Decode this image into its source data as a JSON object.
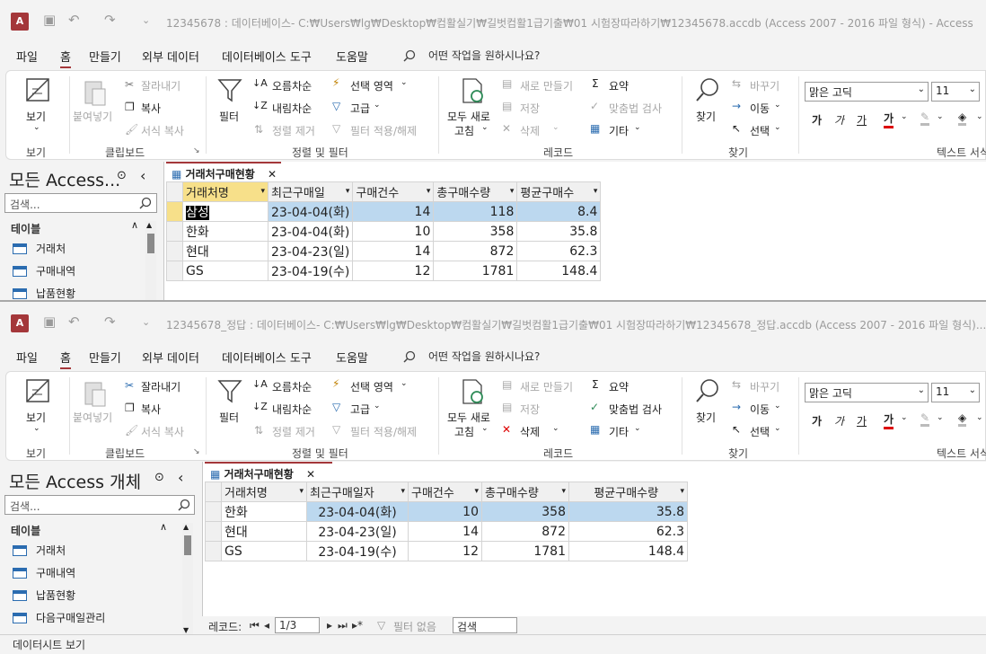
{
  "colors": {
    "accent": "#a4373a",
    "selection": "#bcd8ef",
    "icon_blue": "#2b6cb0"
  },
  "app_logo": "A",
  "quick_access": {
    "save_icon": "save-icon",
    "undo": "↶",
    "redo": "↷",
    "more": "⌄"
  },
  "menu": [
    "파일",
    "홈",
    "만들기",
    "외부 데이터",
    "데이터베이스 도구",
    "도움말"
  ],
  "tell_me": "어떤 작업을 원하시나요?",
  "ribbon": {
    "view": "보기",
    "view_group": "보기",
    "paste": "붙여넣기",
    "cut": "잘라내기",
    "copy": "복사",
    "format_painter": "서식 복사",
    "clipboard_group": "클립보드",
    "filter": "필터",
    "ascending": "오름차순",
    "descending": "내림차순",
    "remove_sort": "정렬 제거",
    "selection": "선택 영역",
    "advanced": "고급",
    "toggle_filter": "필터 적용/해제",
    "sort_group": "정렬 및 필터",
    "refresh_all_1": "모두 새로",
    "refresh_all_2": "고침",
    "new": "새로 만들기",
    "save": "저장",
    "delete": "삭제",
    "totals": "요약",
    "spelling": "맞춤법 검사",
    "more": "기타",
    "records_group": "레코드",
    "find": "찾기",
    "replace": "바꾸기",
    "goto": "이동",
    "select": "선택",
    "find_group": "찾기",
    "font": "맑은 고딕",
    "font_size": "11",
    "bold": "가",
    "italic": "가",
    "underline": "가",
    "font_color": "가",
    "text_group": "텍스트 서식"
  },
  "window1": {
    "title": "12345678 : 데이터베이스- C:₩Users₩lg₩Desktop₩컴활실기₩길벗컴활1급기출₩01 시험장따라하기₩12345678.accdb (Access 2007 - 2016 파일 형식)  -  Access",
    "nav_title": "모든 Access...",
    "search_placeholder": "검색...",
    "section": "테이블",
    "nav_items": [
      "거래처",
      "구매내역",
      "납품현황"
    ],
    "tab": "거래처구매현황",
    "columns": [
      "거래처명",
      "최근구매일",
      "구매건수",
      "총구매수량",
      "평균구매수"
    ],
    "rows": [
      [
        "삼성",
        "23-04-04(화)",
        "14",
        "118",
        "8.4"
      ],
      [
        "한화",
        "23-04-04(화)",
        "10",
        "358",
        "35.8"
      ],
      [
        "현대",
        "23-04-23(일)",
        "14",
        "872",
        "62.3"
      ],
      [
        "GS",
        "23-04-19(수)",
        "12",
        "1781",
        "148.4"
      ]
    ]
  },
  "window2": {
    "title": "12345678_정답 : 데이터베이스- C:₩Users₩lg₩Desktop₩컴활실기₩길벗컴활1급기출₩01 시험장따라하기₩12345678_정답.accdb (Access 2007 - 2016 파일 형식)...",
    "nav_title": "모든 Access 개체",
    "search_placeholder": "검색...",
    "section": "테이블",
    "nav_items": [
      "거래처",
      "구매내역",
      "납품현황",
      "다음구매일관리"
    ],
    "tab": "거래처구매현황",
    "columns": [
      "거래처명",
      "최근구매일자",
      "구매건수",
      "총구매수량",
      "평균구매수량"
    ],
    "rows": [
      [
        "한화",
        "23-04-04(화)",
        "10",
        "358",
        "35.8"
      ],
      [
        "현대",
        "23-04-23(일)",
        "14",
        "872",
        "62.3"
      ],
      [
        "GS",
        "23-04-19(수)",
        "12",
        "1781",
        "148.4"
      ]
    ],
    "record_label": "레코드:",
    "record_pos": "1/3",
    "no_filter": "필터 없음",
    "search": "검색",
    "status": "데이터시트 보기"
  }
}
